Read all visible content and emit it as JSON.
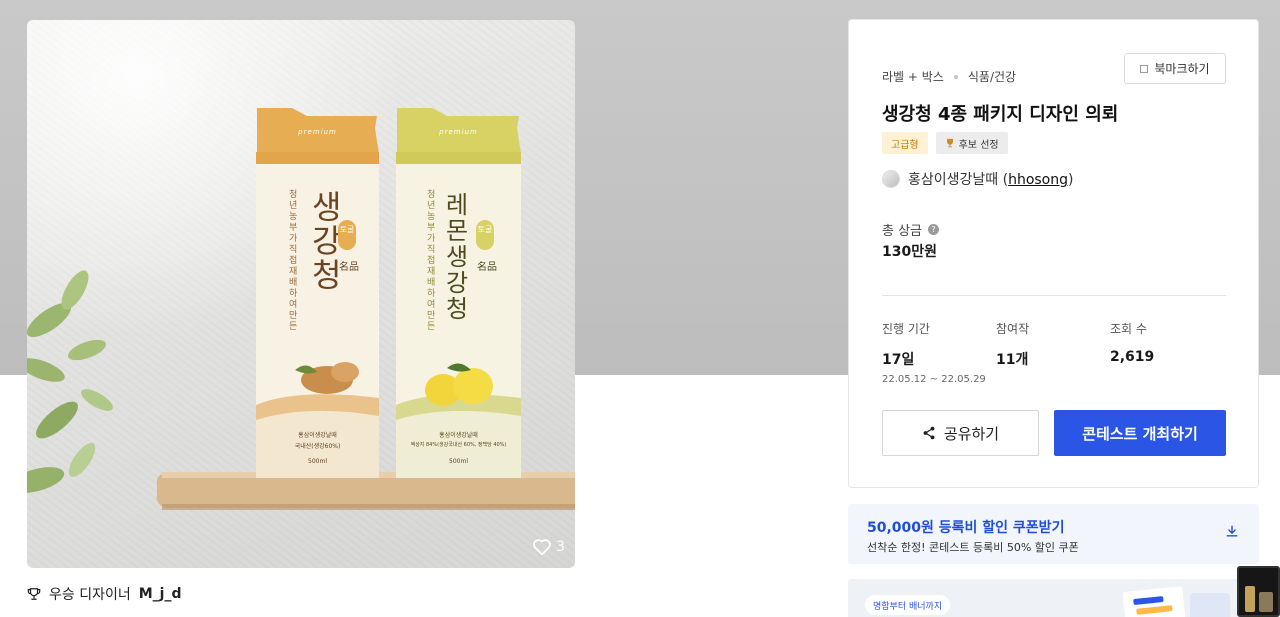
{
  "hero": {
    "packages": [
      {
        "brand": "토굴",
        "name": "생강청",
        "tagline": "청년농부가 직접 재배하여 만든",
        "seal": "名品",
        "label_top": "premium",
        "maker": "홍삼이생강날때",
        "ingredient": "국내산(생강60%)",
        "volume": "500ml",
        "color": "#e6ad52"
      },
      {
        "brand": "토굴",
        "name": "레몬생강청",
        "tagline": "청년농부가 직접 재배하여 만든",
        "seal": "名品",
        "label_top": "premium",
        "maker": "홍삼이생강날때",
        "ingredient": "엑상지 84%(생강국내산 60%, 정백당 40%)",
        "volume": "500ml",
        "color": "#d7d263"
      }
    ],
    "like_count": "3"
  },
  "winner": {
    "label": "우승 디자이너",
    "name": "M_j_d"
  },
  "card": {
    "category": "라벨 + 박스",
    "subcategory": "식품/건강",
    "bookmark_label": "북마크하기",
    "title": "생강청 4종 패키지 디자인 의뢰",
    "badge_grade": "고급형",
    "badge_pick": "후보 선정",
    "owner_name": "홍삼이생강날때 (",
    "owner_handle": "hhosong",
    "owner_close": ")",
    "prize_label": "총 상금",
    "prize_value": "130만원",
    "stats": [
      {
        "label": "진행 기간",
        "value": "17일",
        "sub": "22.05.12 ~ 22.05.29"
      },
      {
        "label": "참여작",
        "value": "11개",
        "sub": ""
      },
      {
        "label": "조회 수",
        "value": "2,619",
        "sub": ""
      }
    ],
    "share_label": "공유하기",
    "host_label": "콘테스트 개최하기"
  },
  "coupon": {
    "title": "50,000원 등록비 할인 쿠폰받기",
    "subtitle": "선착순 한정! 콘테스트 등록비 50% 할인 쿠폰"
  },
  "banner": {
    "tag": "명함부터 배너까지"
  },
  "colors": {
    "accent": "#2a55e5",
    "coupon_text": "#1f4fd6",
    "grade_badge": "#c27a00"
  }
}
